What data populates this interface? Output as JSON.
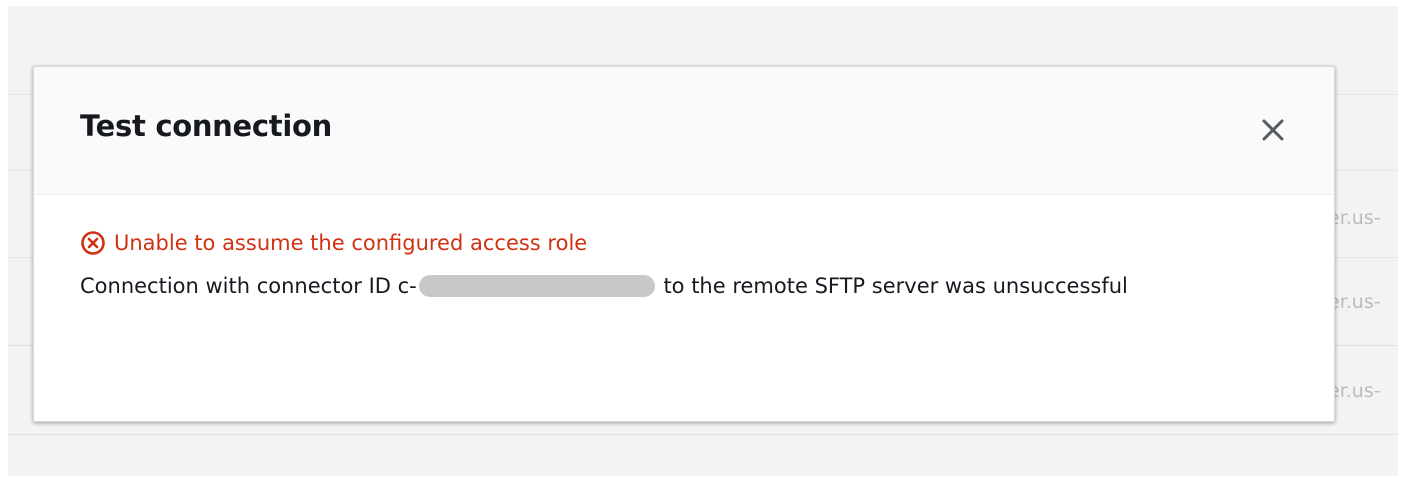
{
  "background": {
    "row_text_fragments": [
      "er.us-",
      "er.us-",
      "er.us-"
    ]
  },
  "modal": {
    "title": "Test connection",
    "close_icon": "close-icon",
    "error": {
      "icon": "error-circle-x-icon",
      "color": "#d13212",
      "text": "Unable to assume the configured access role"
    },
    "message": {
      "prefix": "Connection with connector ID c-",
      "redacted_value": "",
      "suffix": " to the remote SFTP server was unsuccessful"
    }
  }
}
